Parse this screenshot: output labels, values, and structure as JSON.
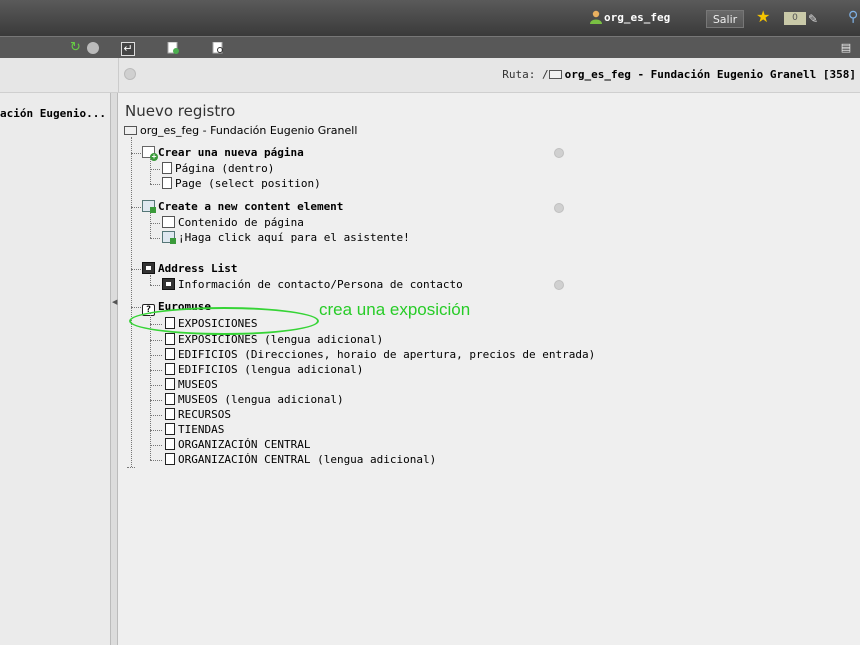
{
  "topbar": {
    "username": "org_es_feg",
    "logout_label": "Salir",
    "badge_count": "0"
  },
  "pathbar": {
    "ruta_label": "Ruta: /",
    "ruta_value": "org_es_feg - Fundación Eugenio Granell [358]"
  },
  "sidebar": {
    "item": "ación Eugenio..."
  },
  "main": {
    "heading": "Nuevo registro",
    "root": "org_es_feg - Fundación Eugenio Granell",
    "groups": {
      "new_page": {
        "title": "Crear una nueva página",
        "items": [
          "Página (dentro)",
          "Page (select position)"
        ]
      },
      "content_element": {
        "title": "Create a new content element",
        "items": [
          "Contenido de página",
          "¡Haga click aquí para el asistente!"
        ]
      },
      "address": {
        "title": "Address List",
        "items": [
          "Información de contacto/Persona de contacto"
        ]
      },
      "euromuse": {
        "title": "Euromuse",
        "items": [
          "EXPOSICIONES",
          "EXPOSICIONES (lengua adicional)",
          "EDIFICIOS (Direcciones, horaio de apertura, precios de entrada)",
          "EDIFICIOS (lengua adicional)",
          "MUSEOS",
          "MUSEOS (lengua adicional)",
          "RECURSOS",
          "TIENDAS",
          "ORGANIZACIÓN CENTRAL",
          "ORGANIZACIÓN CENTRAL (lengua adicional)"
        ]
      }
    }
  },
  "annotation": {
    "text": "crea una exposición",
    "color": "#28cc28"
  },
  "colors": {
    "topbar": "#3a3a3a",
    "toolbar": "#585858",
    "panel": "#efefef"
  }
}
